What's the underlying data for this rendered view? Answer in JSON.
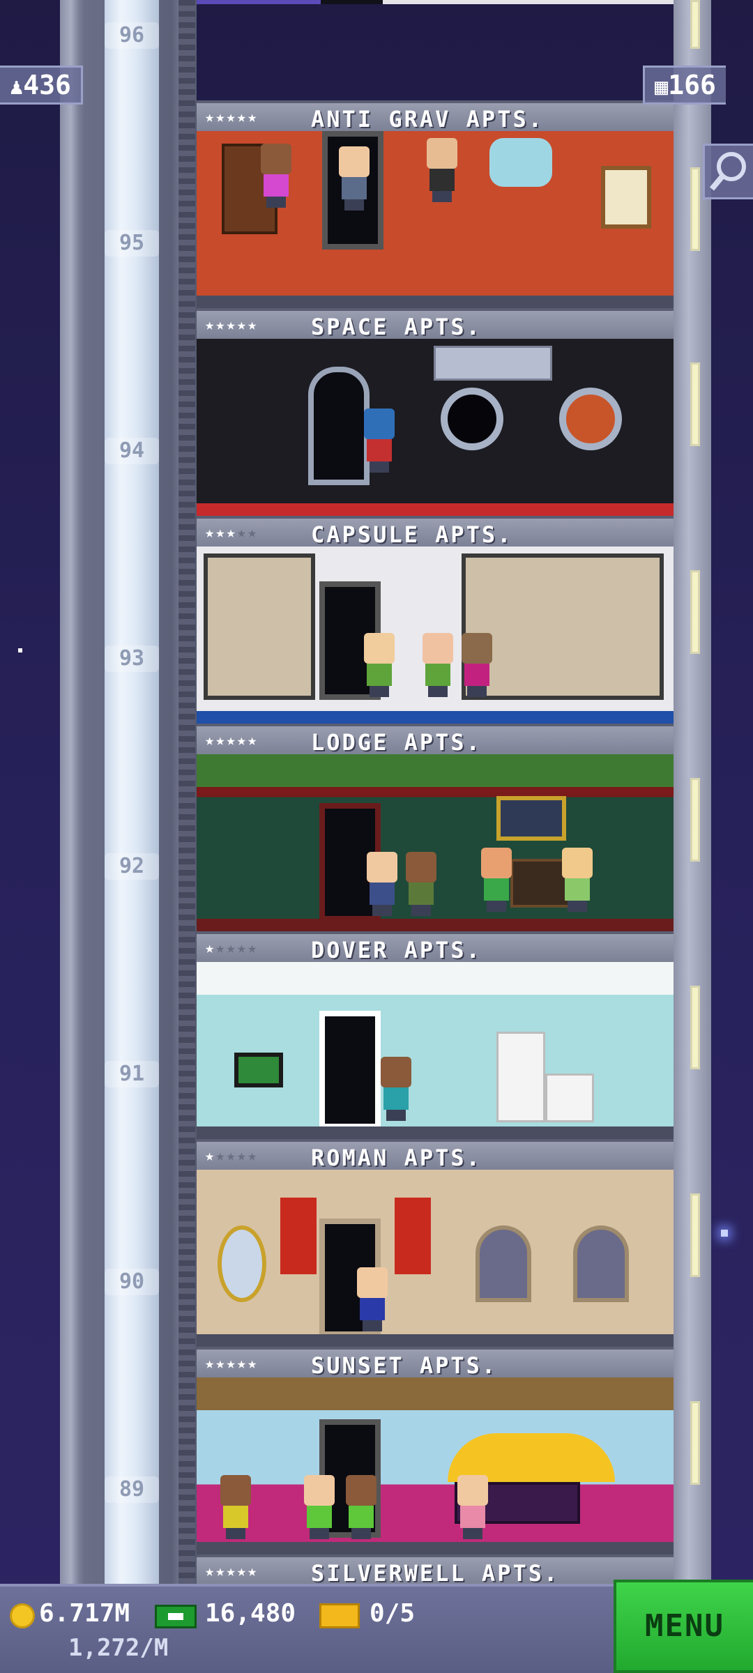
{
  "hud": {
    "population": "436",
    "floors": "166",
    "population_icon": "person-icon",
    "floors_icon": "building-icon",
    "search_icon": "magnifier-icon"
  },
  "floors": [
    {
      "number": "96",
      "name": "",
      "stars": 0
    },
    {
      "number": "95",
      "name": "ANTI GRAV APTS.",
      "stars": 5
    },
    {
      "number": "94",
      "name": "SPACE APTS.",
      "stars": 5
    },
    {
      "number": "93",
      "name": "CAPSULE APTS.",
      "stars": 3
    },
    {
      "number": "92",
      "name": "LODGE APTS.",
      "stars": 5
    },
    {
      "number": "91",
      "name": "DOVER APTS.",
      "stars": 1
    },
    {
      "number": "90",
      "name": "ROMAN APTS.",
      "stars": 1
    },
    {
      "number": "89",
      "name": "SUNSET APTS.",
      "stars": 5
    },
    {
      "number": "",
      "name": "SILVERWELL APTS.",
      "stars": 5
    }
  ],
  "bottom_bar": {
    "coins": "6.717M",
    "coin_rate": "1,272/M",
    "bux": "16,480",
    "tickets": "0/5",
    "menu_label": "MENU"
  },
  "colors": {
    "menu_green": "#2fc23b",
    "hud_panel": "#686c96",
    "sky": "#27215a"
  }
}
